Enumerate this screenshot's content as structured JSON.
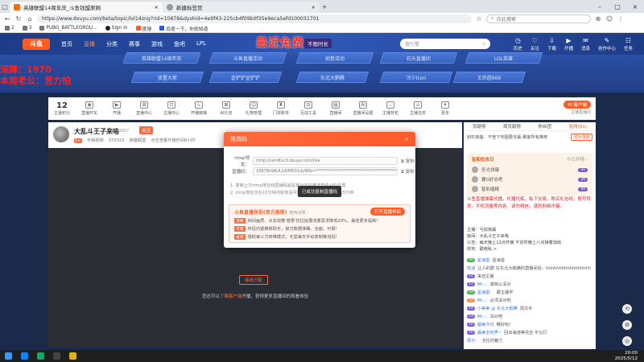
{
  "browser": {
    "tabs": [
      {
        "title": "英雄联盟14周年庆_斗鱼钱盟原网"
      },
      {
        "title": "新建标签页"
      }
    ],
    "url": "https://www.douyu.com/beta/topic/lol14zng?rid=10878&dyshid=4e9f43-225cb4f09b0f35e9eca5efd100031701",
    "search_placeholder": "点此搜索",
    "bookmarks": [
      "2",
      "3",
      "PUBG_BATTLEGROU...",
      "Sign In",
      "度搜",
      "百度一下，你就知道"
    ]
  },
  "site": {
    "logo": "斗鱼",
    "nav": [
      "首页",
      "直播",
      "分类",
      "赛事",
      "游戏",
      "鱼吧",
      "LPL"
    ],
    "nav_active_index": 1,
    "nav_arrows": {
      "2": "▾",
      "4": "▾"
    },
    "promo_text": "最近免费",
    "promo_tag": "不限时长",
    "search_placeholder": "搜引擎",
    "header_icons": [
      {
        "label": "历史",
        "glyph": "◷"
      },
      {
        "label": "关注",
        "glyph": "♡"
      },
      {
        "label": "下载",
        "glyph": "⇩"
      },
      {
        "label": "开播",
        "glyph": "▶"
      },
      {
        "label": "消息",
        "glyph": "✉"
      },
      {
        "label": "创作中心",
        "glyph": "✎"
      },
      {
        "label": "任务",
        "glyph": "☷"
      }
    ]
  },
  "categories_row1": [
    "英雄联盟14周年庆",
    "斗鱼直播活动",
    "创意活动",
    "石头直播间",
    "LOL英雄"
  ],
  "categories_row2": [
    "放置大佬",
    "金铲铲金铲铲",
    "东北大鹅腾",
    "冷少lcon",
    "王炸超666"
  ],
  "ad_left": [
    "深蹲：1970",
    "本周老公：苦力怕"
  ],
  "toolbar": {
    "level": "12",
    "level_label": "主播积分",
    "tools": [
      "直播开关",
      "开播",
      "直播中心",
      "主播中心",
      "开播链接",
      "AI礼包",
      "礼物管理",
      "门票账单",
      "互动工具",
      "直播间",
      "直播间设置",
      "主播背包",
      "主播任务",
      "更多"
    ],
    "tool_glyphs": [
      "◉",
      "▶",
      "⊞",
      "⊡",
      "∿",
      "⊠",
      "☺",
      "♜",
      "⊟",
      "▤",
      "AI",
      "♤",
      "⌂",
      "✦",
      "∽"
    ],
    "pc_button": "PC客户端",
    "pc_sub": "主播直播间"
  },
  "room": {
    "title": "大乱斗王子来咯",
    "room_id": "2469807",
    "follow": "关注",
    "level_badge": "Lv",
    "meta": [
      "专辑视频",
      "370325",
      "英雄联盟",
      "点击查看开播时间8小时"
    ]
  },
  "video": {
    "open_live_label": "接收分配",
    "hint_prefix": "您还可以",
    "hint_link": "下载客户端",
    "hint_suffix": "开播，获得更多直播间的观看体验"
  },
  "modal": {
    "title": "推流码",
    "close": "×",
    "rtmp_label": "rtmp地址：",
    "rtmp_value": "rtmp://sendtvc3.douyu.com/live",
    "code_label": "直播码：",
    "code_value": "10878nWiUL1A/MK31dy9ftb=************************************************Ix&roirecognition",
    "copy_label": "复制",
    "note1": "1. 复制上方rtmp地址和直播码粘贴到对应的推流软件对应位置",
    "note2": "2. rtmp地址仅在10分钟内有效请尽快使用，直播码有效期为5分钟",
    "toast": "已成功复制直播码",
    "tool_title": "斗鱼直播伴侣(官方推荐)",
    "tool_sub": "使用说明 ›",
    "tool_button": "打开直播伴侣",
    "features": [
      {
        "tag": "流畅",
        "text": "帧间画质、水友观看'普惠'抗拉延展流量需求降低20%，最佳更多提高!"
      },
      {
        "tag": "可靠",
        "text": "伴侣内置推荐助手，官方数据准确、全面、可靠!"
      },
      {
        "tag": "省流",
        "text": "借助第三方转推模式，无需每天手动复制推流码!"
      }
    ]
  },
  "rpanel": {
    "tabs": [
      "贡献榜",
      "周贡献榜",
      "粉丝团",
      "贴榜(81)"
    ],
    "active_tab": 3,
    "notice": "斜杠装备：不管下地图要去赢,看客所有推荐",
    "notice_btn": "成为贵族",
    "rank_title": "钻和拉去日",
    "rank_sub": "今日开榜 ›",
    "rank": [
      {
        "name": "圣光领爆",
        "pts": "31"
      },
      {
        "name": "要O好去吧",
        "pts": "30"
      },
      {
        "name": "智彩磕粮",
        "pts": "30"
      }
    ],
    "red_text": "斗鱼直播弹幕代播，代播代练、私下交易、购买礼包码、账号转卖，手机流量等内容、请勿相信，谨防网络诈骗。",
    "info": [
      "主播：亏损我最",
      "房间：大乱斗王子来咯",
      "公告：每天晚上12点开播 不定时晚上八点接着加班",
      "财务：联络私 >"
    ],
    "chat": [
      {
        "badge": "30",
        "cls": "g",
        "name": "星海雷",
        "text": "星海雷"
      },
      {
        "badge": "",
        "cls": "",
        "name": "欢迎",
        "text": "让人的群 在东北大鹅腾的直播间说：hhhhhhhhhhhhhhhhh"
      },
      {
        "badge": "14",
        "cls": "",
        "name": "",
        "text": "来自主播"
      },
      {
        "badge": "11",
        "cls": "",
        "name": "Mr...:",
        "text": "真特么清对"
      },
      {
        "badge": "33",
        "cls": "g",
        "name": "星海雷：",
        "text": "跟主播学"
      },
      {
        "badge": "37",
        "cls": "o",
        "name": "Mr...:",
        "text": "必须清对吧"
      },
      {
        "badge": "18",
        "cls": "",
        "name": "小美美 @ 东北大鹅腾",
        "text": "周次手"
      },
      {
        "badge": "23",
        "cls": "",
        "name": "Mr...:",
        "text": "清对吧"
      },
      {
        "badge": "18",
        "cls": "",
        "name": "最美今日",
        "text": "嗷好哈!"
      },
      {
        "badge": "10",
        "cls": "",
        "name": "最美全世界~",
        "text": "回出海道等花全 平台打"
      },
      {
        "badge": "",
        "cls": "",
        "name": "周子：",
        "text": "全拉的魅力"
      }
    ]
  },
  "right_tools": [
    "⟲",
    "⚙",
    "◎"
  ],
  "taskbar": {
    "icons": [
      "#0a84ff",
      "#1fa463",
      "#444444",
      "#e0b020"
    ],
    "time": "20:00",
    "date": "2025/5/12"
  }
}
